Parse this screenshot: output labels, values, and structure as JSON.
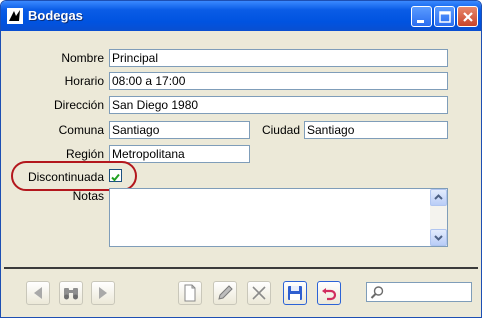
{
  "window": {
    "title": "Bodegas"
  },
  "form": {
    "nombre": {
      "label": "Nombre",
      "value": "Principal"
    },
    "horario": {
      "label": "Horario",
      "value": "08:00 a 17:00"
    },
    "direccion": {
      "label": "Dirección",
      "value": "San Diego 1980"
    },
    "comuna": {
      "label": "Comuna",
      "value": "Santiago"
    },
    "ciudad": {
      "label": "Ciudad",
      "value": "Santiago"
    },
    "region": {
      "label": "Región",
      "value": "Metropolitana"
    },
    "discontinuada": {
      "label": "Discontinuada",
      "checked": true
    },
    "notas": {
      "label": "Notas",
      "value": ""
    }
  },
  "toolbar": {
    "buttons": [
      "previous-record",
      "search-records",
      "next-record",
      "new-record",
      "edit-record",
      "delete-record",
      "save-record",
      "undo-changes"
    ],
    "search": {
      "placeholder": ""
    }
  },
  "colors": {
    "highlight": "#b3171d",
    "titlebar": "#0053e0"
  }
}
